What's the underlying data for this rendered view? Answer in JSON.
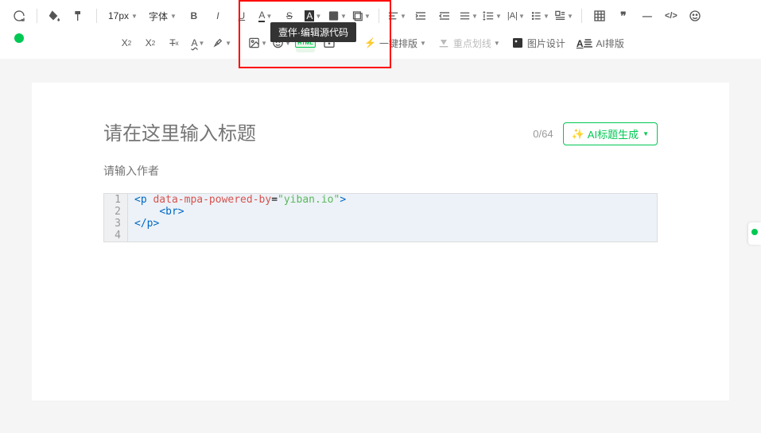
{
  "toolbar": {
    "font_size": "17px",
    "font_family": "字体",
    "tooltip": "壹伴·编辑源代码",
    "one_click_layout": "一键排版",
    "key_underline": "重点划线",
    "image_design": "图片设计",
    "ai_layout": "AI排版"
  },
  "editor": {
    "title_placeholder": "请在这里输入标题",
    "title_counter": "0/64",
    "ai_title_button": "AI标题生成",
    "author_placeholder": "请输入作者",
    "code": {
      "lines": [
        {
          "num": "1",
          "raw": "<p data-mpa-powered-by=\"yiban.io\">"
        },
        {
          "num": "2",
          "raw": "  <br>"
        },
        {
          "num": "3",
          "raw": "</p>"
        },
        {
          "num": "4",
          "raw": ""
        }
      ]
    }
  }
}
